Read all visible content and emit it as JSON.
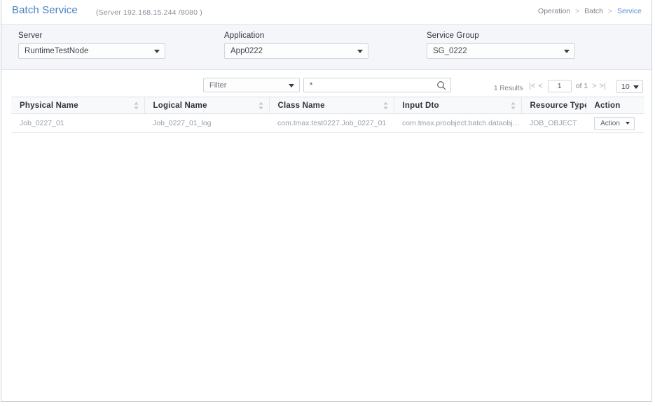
{
  "header": {
    "title": "Batch Service",
    "server_info": "(Server 192.168.15.244 /8080 )",
    "breadcrumb": [
      {
        "label": "Operation",
        "active": false
      },
      {
        "label": "Batch",
        "active": false
      },
      {
        "label": "Service",
        "active": true
      }
    ],
    "breadcrumb_separator": ">"
  },
  "filters": {
    "server": {
      "label": "Server",
      "value": "RuntimeTestNode"
    },
    "application": {
      "label": "Application",
      "value": "App0222"
    },
    "service_group": {
      "label": "Service Group",
      "value": "SG_0222"
    }
  },
  "toolbar": {
    "filter_select_value": "Filter",
    "search_value": "*",
    "search_placeholder": "",
    "search_icon": "search-icon",
    "results_label": "1 Results",
    "page_first_icon": "|<",
    "page_prev_icon": "<",
    "page_next_icon": ">",
    "page_last_icon": ">|",
    "page_current": "1",
    "page_of_label": "of 1",
    "page_size": "10"
  },
  "table": {
    "columns": [
      {
        "label": "Physical Name",
        "sortable": true
      },
      {
        "label": "Logical Name",
        "sortable": true
      },
      {
        "label": "Class Name",
        "sortable": true
      },
      {
        "label": "Input Dto",
        "sortable": true
      },
      {
        "label": "Resource Type",
        "sortable": true
      },
      {
        "label": "Action",
        "sortable": false
      }
    ],
    "rows": [
      {
        "physical_name": "Job_0227_01",
        "logical_name": "Job_0227_01_log",
        "class_name": "com.tmax.test0227.Job_0227_01",
        "input_dto": "com.tmax.proobject.batch.dataobject.De...",
        "resource_type": "JOB_OBJECT",
        "action_label": "Action"
      }
    ]
  },
  "colors": {
    "title_blue": "#4a80c4",
    "breadcrumb_active": "#5b8fd4",
    "panel_bg": "#f4f6fa",
    "header_bg": "#f7f9fb",
    "border": "#dfe3e8"
  }
}
